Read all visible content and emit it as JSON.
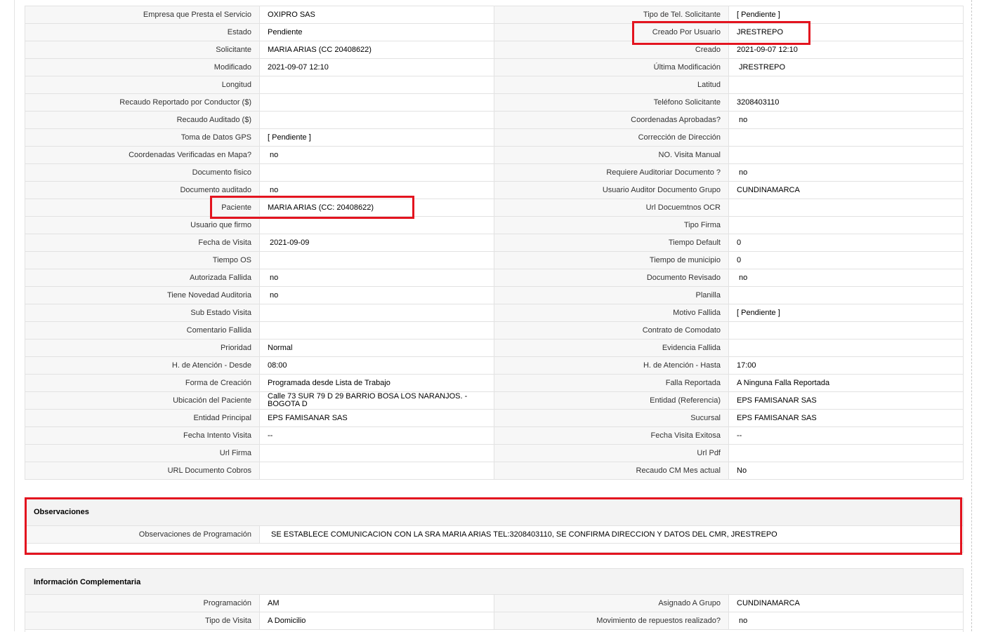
{
  "detail_rows": [
    [
      {
        "label": "Empresa que Presta el Servicio",
        "value": "OXIPRO SAS"
      },
      {
        "label": "Tipo de Tel. Solicitante",
        "value": "[ Pendiente ]"
      }
    ],
    [
      {
        "label": "Estado",
        "value": "Pendiente"
      },
      {
        "label": "Creado Por Usuario",
        "value": "JRESTREPO"
      }
    ],
    [
      {
        "label": "Solicitante",
        "value": "MARIA ARIAS (CC 20408622)"
      },
      {
        "label": "Creado",
        "value": "2021-09-07 12:10"
      }
    ],
    [
      {
        "label": "Modificado",
        "value": "2021-09-07 12:10"
      },
      {
        "label": "Última Modificación",
        "value": " JRESTREPO"
      }
    ],
    [
      {
        "label": "Longitud",
        "value": ""
      },
      {
        "label": "Latitud",
        "value": ""
      }
    ],
    [
      {
        "label": "Recaudo Reportado por Conductor ($)",
        "value": ""
      },
      {
        "label": "Teléfono Solicitante",
        "value": "3208403110"
      }
    ],
    [
      {
        "label": "Recaudo Auditado ($)",
        "value": ""
      },
      {
        "label": "Coordenadas Aprobadas?",
        "value": " no"
      }
    ],
    [
      {
        "label": "Toma de Datos GPS",
        "value": "[ Pendiente ]"
      },
      {
        "label": "Corrección de Dirección",
        "value": ""
      }
    ],
    [
      {
        "label": "Coordenadas Verificadas en Mapa?",
        "value": " no"
      },
      {
        "label": "NO. Visita Manual",
        "value": ""
      }
    ],
    [
      {
        "label": "Documento fisico",
        "value": ""
      },
      {
        "label": "Requiere Auditoriar Documento ?",
        "value": " no"
      }
    ],
    [
      {
        "label": "Documento auditado",
        "value": " no"
      },
      {
        "label": "Usuario Auditor Documento Grupo",
        "value": "CUNDINAMARCA"
      }
    ],
    [
      {
        "label": "Paciente",
        "value": "MARIA ARIAS (CC: 20408622)"
      },
      {
        "label": "Url Docuemtnos OCR",
        "value": ""
      }
    ],
    [
      {
        "label": "Usuario que firmo",
        "value": ""
      },
      {
        "label": "Tipo Firma",
        "value": ""
      }
    ],
    [
      {
        "label": "Fecha de Visita",
        "value": " 2021-09-09"
      },
      {
        "label": "Tiempo Default",
        "value": "0"
      }
    ],
    [
      {
        "label": "Tiempo OS",
        "value": ""
      },
      {
        "label": "Tiempo de municipio",
        "value": "0"
      }
    ],
    [
      {
        "label": "Autorizada Fallida",
        "value": " no"
      },
      {
        "label": "Documento Revisado",
        "value": " no"
      }
    ],
    [
      {
        "label": "Tiene Novedad Auditoria",
        "value": " no"
      },
      {
        "label": "Planilla",
        "value": ""
      }
    ],
    [
      {
        "label": "Sub Estado Visita",
        "value": ""
      },
      {
        "label": "Motivo Fallida",
        "value": "[ Pendiente ]"
      }
    ],
    [
      {
        "label": "Comentario Fallida",
        "value": ""
      },
      {
        "label": "Contrato de Comodato",
        "value": ""
      }
    ],
    [
      {
        "label": "Prioridad",
        "value": "Normal"
      },
      {
        "label": "Evidencia Fallida",
        "value": ""
      }
    ],
    [
      {
        "label": "H. de Atención - Desde",
        "value": "08:00"
      },
      {
        "label": "H. de Atención - Hasta",
        "value": "17:00"
      }
    ],
    [
      {
        "label": "Forma de Creación",
        "value": "Programada desde Lista de Trabajo"
      },
      {
        "label": "Falla Reportada",
        "value": "A Ninguna Falla Reportada"
      }
    ],
    [
      {
        "label": "Ubicación del Paciente",
        "value": "Calle 73 SUR 79 D 29 BARRIO BOSA LOS NARANJOS. - BOGOTA D"
      },
      {
        "label": "Entidad (Referencia)",
        "value": "EPS FAMISANAR SAS"
      }
    ],
    [
      {
        "label": "Entidad Principal",
        "value": "EPS FAMISANAR SAS"
      },
      {
        "label": "Sucursal",
        "value": "EPS FAMISANAR SAS"
      }
    ],
    [
      {
        "label": "Fecha Intento Visita",
        "value": "--"
      },
      {
        "label": "Fecha Visita Exitosa",
        "value": "--"
      }
    ],
    [
      {
        "label": "Url Firma",
        "value": ""
      },
      {
        "label": "Url Pdf",
        "value": ""
      }
    ],
    [
      {
        "label": "URL Documento Cobros",
        "value": ""
      },
      {
        "label": "Recaudo CM Mes actual",
        "value": "No"
      }
    ]
  ],
  "observaciones": {
    "title": "Observaciones",
    "label": "Observaciones de Programación",
    "value": "SE ESTABLECE COMUNICACION CON LA SRA MARIA ARIAS TEL:3208403110, SE CONFIRMA DIRECCION Y DATOS DEL CMR, JRESTREPO"
  },
  "complementaria": {
    "title": "Información Complementaria",
    "rows": [
      [
        {
          "label": "Programación",
          "value": "AM"
        },
        {
          "label": "Asignado A Grupo",
          "value": "CUNDINAMARCA"
        }
      ],
      [
        {
          "label": "Tipo de Visita",
          "value": "A Domicilio"
        },
        {
          "label": "Movimiento de repuestos realizado?",
          "value": " no"
        }
      ]
    ]
  },
  "highlight_color": "#e3141f"
}
